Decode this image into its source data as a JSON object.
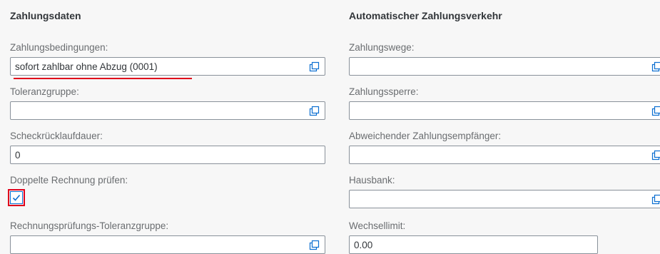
{
  "left": {
    "title": "Zahlungsdaten",
    "fields": {
      "zahlungsbedingungen": {
        "label": "Zahlungsbedingungen:",
        "value": "sofort zahlbar ohne Abzug (0001)"
      },
      "toleranzgruppe": {
        "label": "Toleranzgruppe:",
        "value": ""
      },
      "scheckruecklaufdauer": {
        "label": "Scheckrücklaufdauer:",
        "value": "0"
      },
      "doppelte_rechnung": {
        "label": "Doppelte Rechnung prüfen:",
        "checked": true
      },
      "rp_toleranzgruppe": {
        "label": "Rechnungsprüfungs-Toleranzgruppe:",
        "value": ""
      }
    }
  },
  "right": {
    "title": "Automatischer Zahlungsverkehr",
    "fields": {
      "zahlungswege": {
        "label": "Zahlungswege:",
        "value": ""
      },
      "zahlungssperre": {
        "label": "Zahlungssperre:",
        "value": ""
      },
      "abw_empfaenger": {
        "label": "Abweichender Zahlungsempfänger:",
        "value": ""
      },
      "hausbank": {
        "label": "Hausbank:",
        "value": ""
      },
      "wechsellimit": {
        "label": "Wechsellimit:",
        "value": "0.00"
      }
    }
  },
  "icons": {
    "value_help": "value-help-icon",
    "check": "checkmark-icon"
  },
  "colors": {
    "accent": "#0a6ed1",
    "highlight": "#e0001b"
  }
}
